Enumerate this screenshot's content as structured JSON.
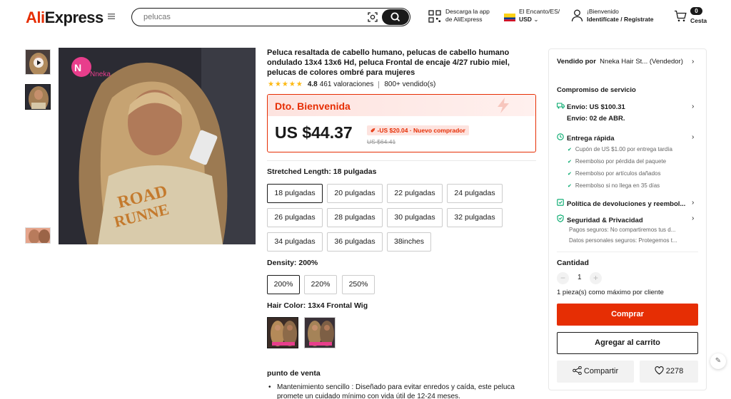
{
  "header": {
    "logo_ali": "Ali",
    "logo_express": "Express",
    "search_placeholder": "pelucas",
    "app_line1": "Descarga la app",
    "app_line2": "de AliExpress",
    "locale_line1": "El Encanto/ES/",
    "locale_line2": "USD",
    "user_line1": "¡Bienvenido",
    "user_line2": "Identifícate / Regístrate",
    "cart_count": "0",
    "cart_label": "Cesta"
  },
  "gallery": {
    "brand_watermark": "Nneka"
  },
  "product": {
    "title": "Peluca resaltada de cabello humano, pelucas de cabello humano ondulado 13x4 13x6 Hd, peluca Frontal de encaje 4/27 rubio miel, pelucas de colores ombré para mujeres",
    "stars": "★★★★★",
    "rating": "4.8",
    "reviews": "461 valoraciones",
    "sold": "800+ vendido(s)"
  },
  "promo": {
    "title": "Dto. Bienvenida",
    "price": "US $44.37",
    "discount": "-US $20.04 · Nuevo comprador",
    "old_price": "US $64.41"
  },
  "length": {
    "label": "Stretched Length:",
    "value": "18 pulgadas",
    "options": [
      "18 pulgadas",
      "20 pulgadas",
      "22 pulgadas",
      "24 pulgadas",
      "26 pulgadas",
      "28 pulgadas",
      "30 pulgadas",
      "32 pulgadas",
      "34 pulgadas",
      "36 pulgadas",
      "38inches"
    ]
  },
  "density": {
    "label": "Density:",
    "value": "200%",
    "options": [
      "200%",
      "220%",
      "250%"
    ]
  },
  "color": {
    "label": "Hair Color:",
    "value": "13x4 Frontal Wig"
  },
  "selling_points": {
    "title": "punto de venta",
    "bullet": "Mantenimiento sencillo : Diseñado para evitar enredos y caída, este peluca promete un cuidado mínimo con vida útil de 12-24 meses."
  },
  "panel": {
    "sold_by_label": "Vendido por",
    "seller_name": "Nneka Hair St...",
    "seller_role": "(Vendedor)",
    "service_title": "Compromiso de servicio",
    "shipping": "Envío: US $100.31",
    "delivery": "Envío: 02 de ABR.",
    "fast_delivery": "Entrega rápida",
    "fast_items": [
      "Cupón de US $1.00 por entrega tardía",
      "Reembolso por pérdida del paquete",
      "Reembolso por artículos dañados",
      "Reembolso si no llega en 35 días"
    ],
    "returns": "Política de devoluciones y reembol...",
    "security": "Seguridad & Privacidad",
    "security_items": [
      "Pagos seguros: No compartiremos tus d...",
      "Datos personales seguros: Protegemos t..."
    ],
    "qty_label": "Cantidad",
    "qty_value": "1",
    "qty_max": "1 pieza(s) como máximo por cliente",
    "buy": "Comprar",
    "add_cart": "Agregar al carrito",
    "share": "Compartir",
    "wishlist_count": "2278"
  },
  "colors": {
    "accent": "#e62e04",
    "success": "#00a86b",
    "star": "#fdb913"
  }
}
